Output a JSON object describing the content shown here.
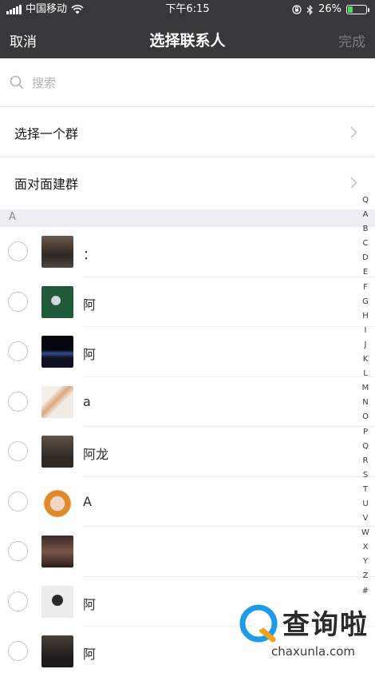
{
  "status_bar": {
    "carrier": "中国移动",
    "time": "下午6:15",
    "battery_text": "26%",
    "battery_level": 0.26
  },
  "nav": {
    "cancel": "取消",
    "title": "选择联系人",
    "done": "完成"
  },
  "search": {
    "placeholder": "搜索"
  },
  "menu": [
    {
      "label": "选择一个群"
    },
    {
      "label": "面对面建群"
    }
  ],
  "section_header": "A",
  "contacts": [
    {
      "name": "："
    },
    {
      "name": "阿"
    },
    {
      "name": "阿"
    },
    {
      "name": "a"
    },
    {
      "name": "阿龙"
    },
    {
      "name": "A"
    },
    {
      "name": ""
    },
    {
      "name": "阿"
    },
    {
      "name": "阿"
    }
  ],
  "index_letters": [
    "Q",
    "A",
    "B",
    "C",
    "D",
    "E",
    "F",
    "G",
    "H",
    "I",
    "J",
    "K",
    "L",
    "M",
    "N",
    "O",
    "P",
    "Q",
    "R",
    "S",
    "T",
    "U",
    "V",
    "W",
    "X",
    "Y",
    "Z",
    "#"
  ],
  "watermark": {
    "title": "查询啦",
    "url": "chaxunla.com"
  },
  "colors": {
    "nav_bg": "#38383a",
    "section_bg": "#ededf2",
    "watermark_accent": "#1e9be8",
    "battery": "#4cd964"
  }
}
